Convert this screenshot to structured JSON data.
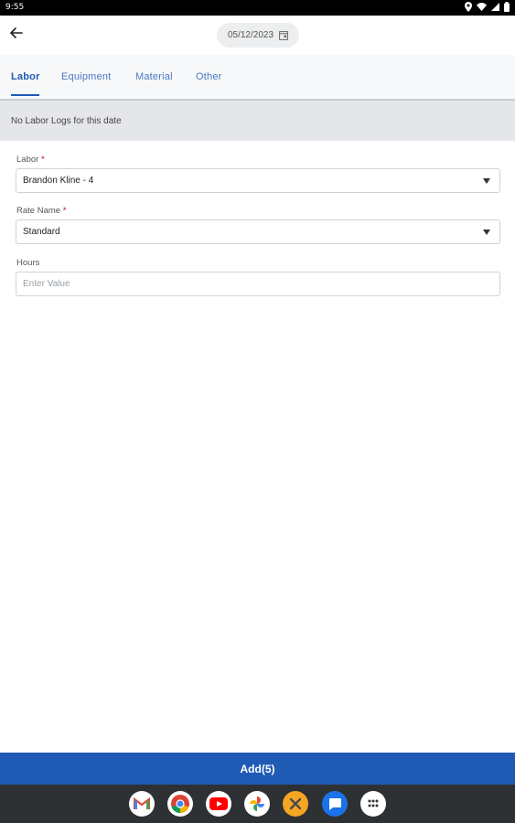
{
  "status_bar": {
    "time": "9:55",
    "icons": [
      "location-icon",
      "wifi-icon",
      "signal-icon",
      "battery-icon"
    ]
  },
  "app_bar": {
    "date": "05/12/2023",
    "back_icon": "arrow-left-icon",
    "calendar_icon": "calendar-icon"
  },
  "tabs": [
    {
      "label": "Labor",
      "active": true
    },
    {
      "label": "Equipment",
      "active": false
    },
    {
      "label": "Material",
      "active": false
    },
    {
      "label": "Other",
      "active": false
    }
  ],
  "banner": {
    "text": "No Labor Logs for this date"
  },
  "form": {
    "labor": {
      "label": "Labor",
      "required_mark": "*",
      "value": "Brandon Kline - 4"
    },
    "rate_name": {
      "label": "Rate Name",
      "required_mark": "*",
      "value": "Standard"
    },
    "hours": {
      "label": "Hours",
      "placeholder": "Enter Value"
    }
  },
  "footer": {
    "add_label": "Add(5)"
  },
  "dock": {
    "apps": [
      "gmail-icon",
      "chrome-icon",
      "youtube-icon",
      "photos-icon",
      "tools-app-icon",
      "messages-icon",
      "app-drawer-icon"
    ]
  },
  "colors": {
    "primary": "#1f5bb5",
    "tab_text": "#4a78c2",
    "banner_bg": "#e4e6e9",
    "required": "#d0021b"
  }
}
